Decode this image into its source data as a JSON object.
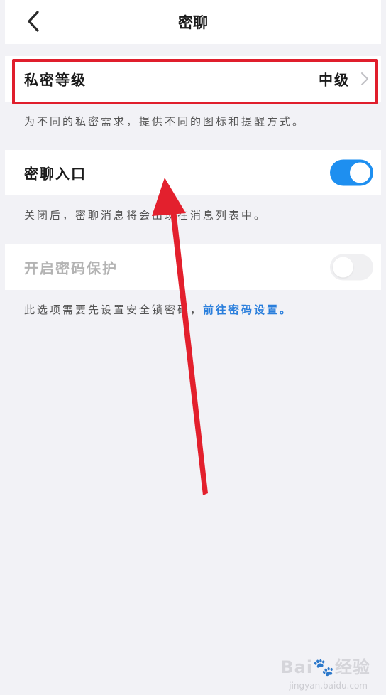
{
  "nav": {
    "title": "密聊",
    "back_icon": "chevron-left-icon"
  },
  "privacy_level": {
    "label": "私密等级",
    "value": "中级",
    "chevron_icon": "chevron-right-icon",
    "hint": "为不同的私密需求，提供不同的图标和提醒方式。"
  },
  "entry": {
    "label": "密聊入口",
    "toggle_on": true,
    "hint": "关闭后，密聊消息将会出现在消息列表中。"
  },
  "password": {
    "label": "开启密码保护",
    "toggle_on": false,
    "disabled": true,
    "hint": "此选项需要先设置安全锁密码，",
    "hint_link": "前往密码设置。"
  },
  "colors": {
    "accent": "#1e8ff0",
    "highlight": "#e01e2c",
    "link": "#2b7fdc",
    "background": "#f2f2f6"
  },
  "watermark": {
    "brand": "Bai",
    "brand_suffix": "经验",
    "domain": "jingyan.baidu.com"
  }
}
